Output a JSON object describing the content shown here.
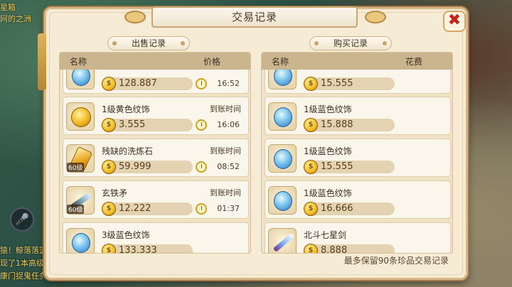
{
  "window": {
    "title": "交易记录",
    "close_label": "✖"
  },
  "background": {
    "left_texts": [
      "星箱",
      "网的之洲",
      "猿！鲸落落篮",
      "现了1本高级",
      "康门捉鬼任务"
    ]
  },
  "sell": {
    "section_title": "出售记录",
    "col_name": "名称",
    "col_value": "价格",
    "rows": [
      {
        "name": "",
        "icon": "gem-icon",
        "level": "",
        "price": "128.887",
        "time_label": "",
        "time": "16:52"
      },
      {
        "name": "1级黄色纹饰",
        "icon": "gold-pattern-icon",
        "level": "",
        "price": "3.555",
        "time_label": "到账时间",
        "time": "16:06"
      },
      {
        "name": "残缺的洗炼石",
        "icon": "refining-stone-icon",
        "level": "60级",
        "price": "59.999",
        "time_label": "到账时间",
        "time": "08:52"
      },
      {
        "name": "玄铁矛",
        "icon": "spear-icon",
        "level": "60级",
        "price": "12.222",
        "time_label": "到账时间",
        "time": "01:37"
      },
      {
        "name": "3级蓝色纹饰",
        "icon": "gem-icon",
        "level": "",
        "price": "133.333",
        "time_label": "",
        "time": ""
      }
    ]
  },
  "buy": {
    "section_title": "购买记录",
    "col_name": "名称",
    "col_value": "花费",
    "rows": [
      {
        "name": "",
        "icon": "gem-icon",
        "level": "",
        "price": "15.555"
      },
      {
        "name": "1级蓝色纹饰",
        "icon": "gem-icon",
        "level": "",
        "price": "15.888"
      },
      {
        "name": "1级蓝色纹饰",
        "icon": "gem-icon",
        "level": "",
        "price": "15.555"
      },
      {
        "name": "1级蓝色纹饰",
        "icon": "gem-icon",
        "level": "",
        "price": "16.666"
      },
      {
        "name": "北斗七星剑",
        "icon": "sword-icon",
        "level": "",
        "price": "8.888"
      }
    ]
  },
  "footer": "最多保留90条珍品交易记录",
  "colors": {
    "panel": "#efe2c6",
    "header": "#cbb58f",
    "accent": "#c8221c"
  }
}
